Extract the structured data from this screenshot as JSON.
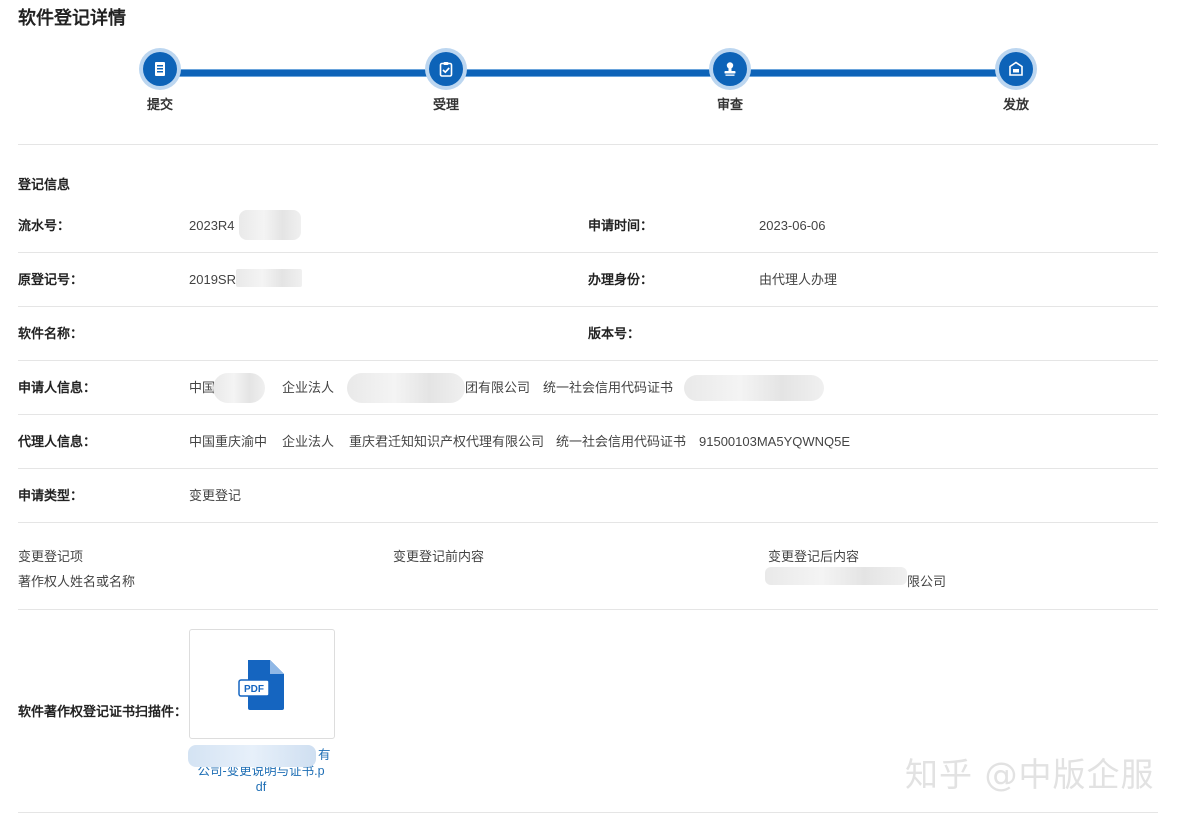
{
  "page_title": "软件登记详情",
  "steps": [
    {
      "label": "提交",
      "icon": "document-icon"
    },
    {
      "label": "受理",
      "icon": "clipboard-check-icon"
    },
    {
      "label": "审查",
      "icon": "stamp-icon"
    },
    {
      "label": "发放",
      "icon": "inbox-icon"
    }
  ],
  "section_title": "登记信息",
  "fields": {
    "serial_no": {
      "label": "流水号：",
      "value": "2023R4"
    },
    "apply_time": {
      "label": "申请时间：",
      "value": "2023-06-06"
    },
    "orig_reg_no": {
      "label": "原登记号：",
      "value": "2019SR"
    },
    "handle_identity": {
      "label": "办理身份：",
      "value": "由代理人办理"
    },
    "software_name": {
      "label": "软件名称：",
      "value": ""
    },
    "version_no": {
      "label": "版本号：",
      "value": ""
    },
    "applicant": {
      "label": "申请人信息：",
      "country": "中国",
      "type": "企业法人",
      "name_suffix": "团有限公司",
      "cert_type": "统一社会信用代码证书"
    },
    "agent": {
      "label": "代理人信息：",
      "location": "中国重庆渝中",
      "type": "企业法人",
      "name": "重庆君迁知知识产权代理有限公司",
      "cert_type": "统一社会信用代码证书",
      "cert_no": "91500103MA5YQWNQ5E"
    },
    "apply_type": {
      "label": "申请类型：",
      "value": "变更登记"
    }
  },
  "change_table": {
    "headers": [
      "变更登记项",
      "变更登记前内容",
      "变更登记后内容"
    ],
    "rows": [
      {
        "item": "著作权人姓名或名称",
        "before": "",
        "after_suffix": "限公司"
      }
    ]
  },
  "attachment": {
    "label": "软件著作权登记证书扫描件：",
    "icon_text": "PDF",
    "filename_lines": [
      "有",
      "公司-变更说明与证书.p",
      "df"
    ]
  },
  "watermark": "知乎 @中版企服",
  "colors": {
    "accent": "#0d63b8",
    "link": "#1f6fb5"
  }
}
